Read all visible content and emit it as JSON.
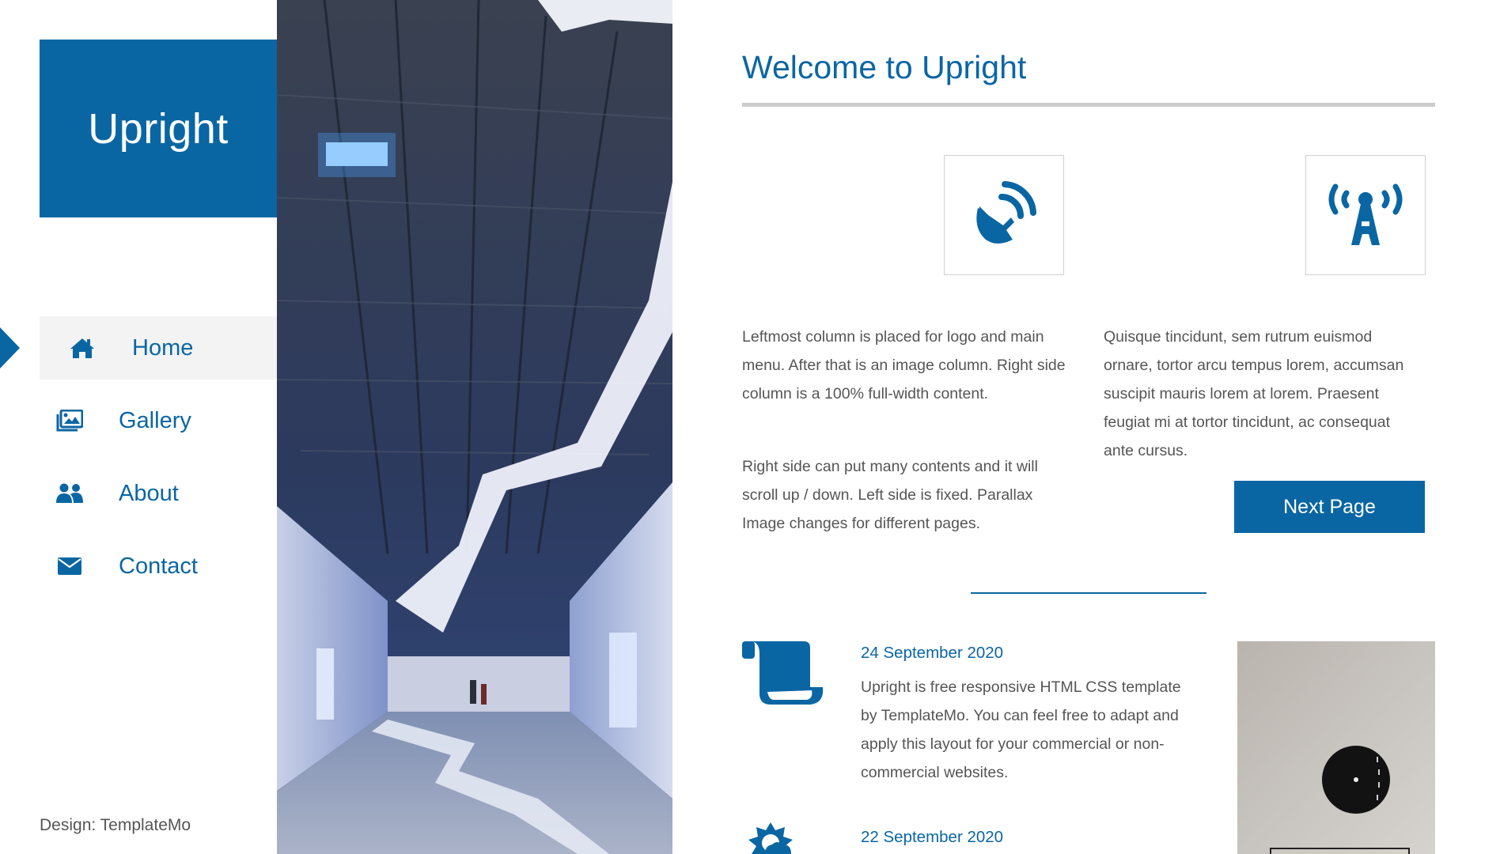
{
  "brand": {
    "name": "Upright",
    "color": "#0a66a3"
  },
  "nav": {
    "items": [
      {
        "label": "Home",
        "icon": "home-icon",
        "active": true
      },
      {
        "label": "Gallery",
        "icon": "images-icon",
        "active": false
      },
      {
        "label": "About",
        "icon": "users-icon",
        "active": false
      },
      {
        "label": "Contact",
        "icon": "envelope-icon",
        "active": false
      }
    ]
  },
  "footer": {
    "credit": "Design: TemplateMo"
  },
  "main": {
    "title": "Welcome to Upright",
    "features": [
      {
        "icon": "satellite-dish-icon"
      },
      {
        "icon": "broadcast-tower-icon"
      }
    ],
    "left_paragraphs": [
      "Leftmost column is placed for logo and main menu. After that is an image column. Right side column is a 100% full-width content.",
      "Right side can put many contents and it will scroll up / down. Left side is fixed. Parallax Image changes for different pages."
    ],
    "right_paragraph": "Quisque tincidunt, sem rutrum euismod ornare, tortor arcu tempus lorem, accumsan suscipit mauris lorem at lorem. Praesent feugiat mi at tortor tincidunt, ac consequat ante cursus.",
    "next_button": "Next Page"
  },
  "posts": [
    {
      "date": "24 September 2020",
      "icon": "scroll-icon",
      "text": "Upright is free responsive HTML CSS template by TemplateMo. You can feel free to adapt and apply this layout for your commercial or non-commercial websites."
    },
    {
      "date": "22 September 2020",
      "icon": "sun-cloud-icon",
      "text": ""
    }
  ]
}
